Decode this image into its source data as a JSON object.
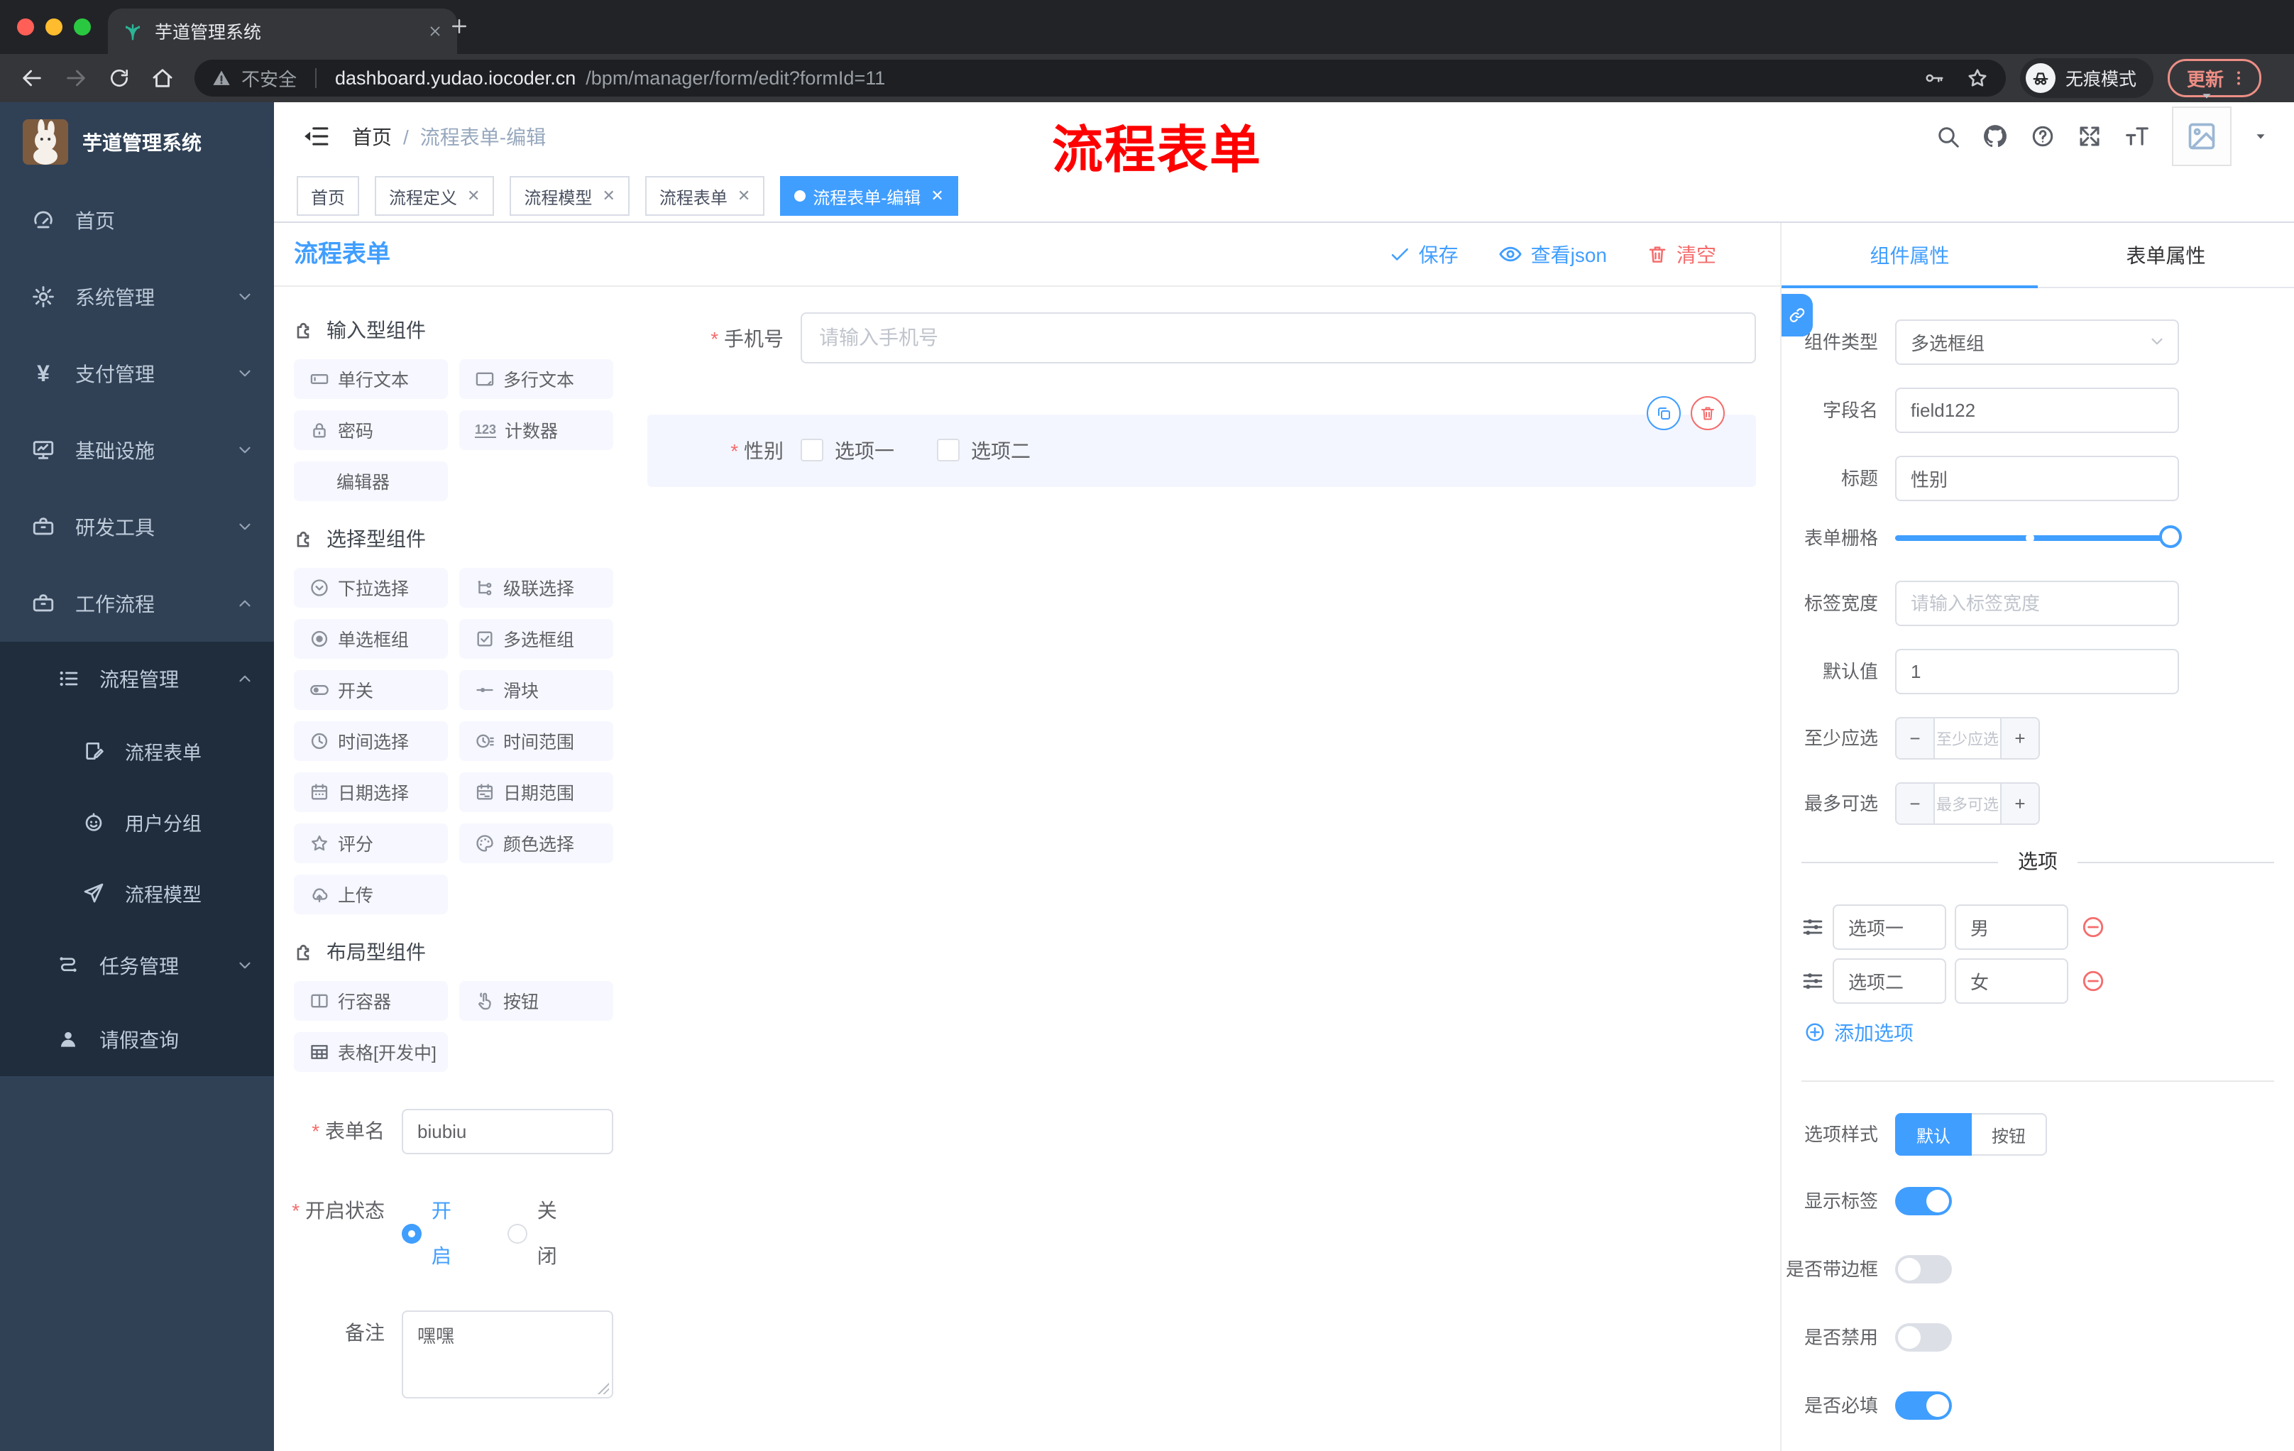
{
  "colors": {
    "accent": "#409eff",
    "danger": "#f56c6c",
    "annotation_red": "#fe0000",
    "sidebar_bg": "#304156",
    "submenu_bg": "#1f2d3d",
    "chrome_bg": "#222327",
    "navbar_bg": "#35363a",
    "update_pill": "#ec8e85",
    "traffic": [
      "#ff5f57",
      "#febc2e",
      "#2ac840"
    ]
  },
  "browser": {
    "tab_title": "芋道管理系统",
    "security_label": "不安全",
    "url_host": "dashboard.yudao.iocoder.cn",
    "url_path": "/bpm/manager/form/edit?formId=11",
    "incognito_label": "无痕模式",
    "update_label": "更新"
  },
  "sidebar": {
    "logo_title": "芋道管理系统",
    "items": [
      {
        "icon": "gauge-icon",
        "label": "首页",
        "chevron": ""
      },
      {
        "icon": "gear-icon",
        "label": "系统管理",
        "chevron": "down"
      },
      {
        "icon": "yen-icon",
        "label": "支付管理",
        "chevron": "down"
      },
      {
        "icon": "monitor-icon",
        "label": "基础设施",
        "chevron": "down"
      },
      {
        "icon": "toolbox-icon",
        "label": "研发工具",
        "chevron": "down"
      },
      {
        "icon": "briefcase-icon",
        "label": "工作流程",
        "chevron": "up"
      }
    ],
    "submenu": [
      {
        "icon": "tree-list-icon",
        "label": "流程管理",
        "chevron": "up",
        "level": 2
      },
      {
        "icon": "doc-edit-icon",
        "label": "流程表单",
        "level": 3
      },
      {
        "icon": "robot-icon",
        "label": "用户分组",
        "level": 3
      },
      {
        "icon": "paper-plane-icon",
        "label": "流程模型",
        "level": 3
      },
      {
        "icon": "flow-icon",
        "label": "任务管理",
        "chevron": "down",
        "level": 2
      },
      {
        "icon": "person-icon",
        "label": "请假查询",
        "level": 2
      }
    ]
  },
  "header": {
    "breadcrumb": [
      "首页",
      "流程表单-编辑"
    ],
    "annotation": "流程表单",
    "yen_glyph": "¥"
  },
  "tagbar": {
    "tags": [
      {
        "label": "首页",
        "closable": false,
        "active": false
      },
      {
        "label": "流程定义",
        "closable": true,
        "active": false
      },
      {
        "label": "流程模型",
        "closable": true,
        "active": false
      },
      {
        "label": "流程表单",
        "closable": true,
        "active": false
      },
      {
        "label": "流程表单-编辑",
        "closable": true,
        "active": true
      }
    ],
    "close_glyph": "✕"
  },
  "palette": {
    "title": "流程表单",
    "sections": [
      {
        "label": "输入型组件",
        "items": [
          {
            "icon": "input-icon",
            "label": "单行文本"
          },
          {
            "icon": "textarea-icon",
            "label": "多行文本"
          },
          {
            "icon": "lock-icon",
            "label": "密码"
          },
          {
            "icon": "counter-icon",
            "label": "计数器",
            "icon_text": "123"
          },
          {
            "icon": "",
            "label": "编辑器"
          }
        ]
      },
      {
        "label": "选择型组件",
        "items": [
          {
            "icon": "select-icon",
            "label": "下拉选择"
          },
          {
            "icon": "cascade-icon",
            "label": "级联选择"
          },
          {
            "icon": "radio-icon",
            "label": "单选框组"
          },
          {
            "icon": "checkbox-icon",
            "label": "多选框组"
          },
          {
            "icon": "switch-icon",
            "label": "开关"
          },
          {
            "icon": "slider-icon",
            "label": "滑块"
          },
          {
            "icon": "clock-icon",
            "label": "时间选择"
          },
          {
            "icon": "clock-range-icon",
            "label": "时间范围"
          },
          {
            "icon": "calendar-icon",
            "label": "日期选择"
          },
          {
            "icon": "calendar-range-icon",
            "label": "日期范围"
          },
          {
            "icon": "star-icon",
            "label": "评分"
          },
          {
            "icon": "palette-icon",
            "label": "颜色选择"
          },
          {
            "icon": "upload-icon",
            "label": "上传"
          }
        ]
      },
      {
        "label": "布局型组件",
        "items": [
          {
            "icon": "columns-icon",
            "label": "行容器"
          },
          {
            "icon": "hand-icon",
            "label": "按钮"
          },
          {
            "icon": "table-icon",
            "label": "表格[开发中]"
          }
        ]
      }
    ],
    "form": {
      "name_label": "表单名",
      "name_value": "biubiu",
      "status_label": "开启状态",
      "status_on": "开启",
      "status_off": "关闭",
      "remark_label": "备注",
      "remark_value": "嘿嘿"
    }
  },
  "canvas": {
    "toolbar": {
      "save": "保存",
      "view_json": "查看json",
      "clear": "清空"
    },
    "phone_field": {
      "label": "手机号",
      "placeholder": "请输入手机号",
      "value": ""
    },
    "gender_field": {
      "label": "性别",
      "options": [
        "选项一",
        "选项二"
      ]
    }
  },
  "panel": {
    "tabs": [
      "组件属性",
      "表单属性"
    ],
    "component_type": {
      "label": "组件类型",
      "value": "多选框组"
    },
    "field_name": {
      "label": "字段名",
      "value": "field122"
    },
    "title": {
      "label": "标题",
      "value": "性别"
    },
    "grid": {
      "label": "表单栅格"
    },
    "label_width": {
      "label": "标签宽度",
      "placeholder": "请输入标签宽度"
    },
    "default_value": {
      "label": "默认值",
      "value": "1"
    },
    "min_checked": {
      "label": "至少应选",
      "placeholder": "至少应选"
    },
    "max_checked": {
      "label": "最多可选",
      "placeholder": "最多可选"
    },
    "options_title": "选项",
    "options": [
      {
        "value": "选项一",
        "text": "男"
      },
      {
        "value": "选项二",
        "text": "女"
      }
    ],
    "add_option": "添加选项",
    "option_style": {
      "label": "选项样式",
      "choices": [
        "默认",
        "按钮"
      ],
      "selected": "默认"
    },
    "switches": [
      {
        "label": "显示标签",
        "on": true
      },
      {
        "label": "是否带边框",
        "on": false
      },
      {
        "label": "是否禁用",
        "on": false
      },
      {
        "label": "是否必填",
        "on": true
      }
    ],
    "stepper_minus": "−",
    "stepper_plus": "+"
  }
}
